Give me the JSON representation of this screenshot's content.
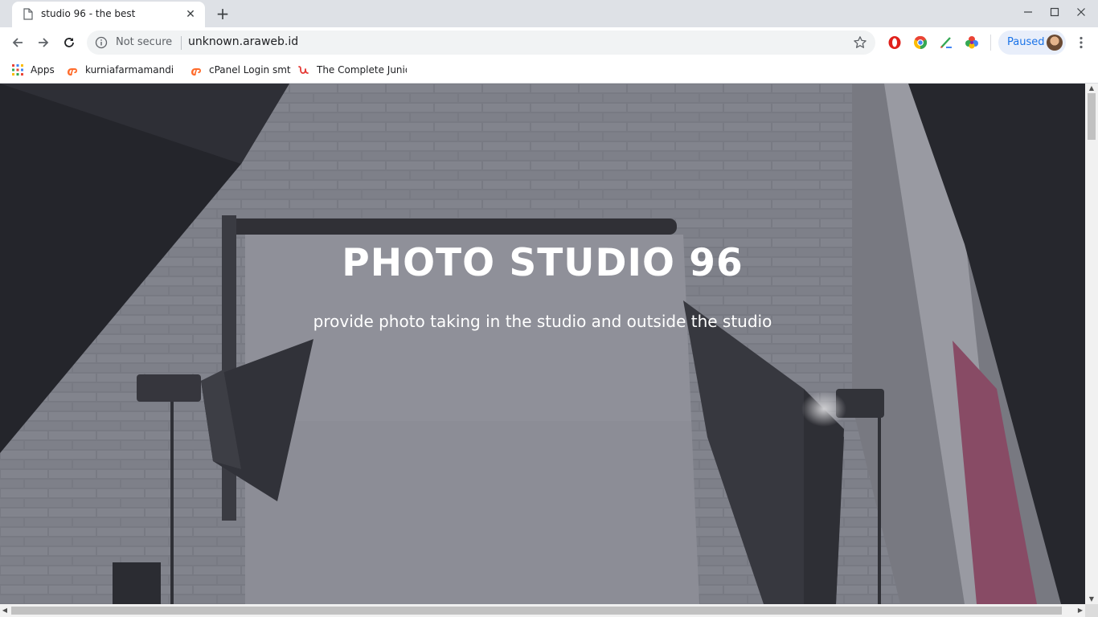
{
  "browser": {
    "tab": {
      "title": "studio 96 - the best",
      "close_glyph": "✕"
    },
    "new_tab_glyph": "+",
    "window_controls": {
      "minimize": "—",
      "maximize": "☐",
      "close": "✕"
    },
    "omnibox": {
      "security_label": "Not secure",
      "url": "unknown.araweb.id"
    },
    "profile": {
      "label": "Paused"
    },
    "extensions": [
      "opera-icon",
      "chrome-colored-icon",
      "paint-brush-icon",
      "color-wheel-icon"
    ]
  },
  "bookmarks": [
    {
      "label": "Apps",
      "icon": "apps-grid-icon"
    },
    {
      "label": "kurniafarmamandiri",
      "icon": "cpanel-icon"
    },
    {
      "label": "cPanel Login smt",
      "icon": "cpanel-icon"
    },
    {
      "label": "The Complete Junior",
      "icon": "script-u-icon"
    }
  ],
  "hero": {
    "title": "PHOTO STUDIO 96",
    "subtitle": "provide photo taking in the studio and outside the studio"
  },
  "colors": {
    "accent": "#1a73e8",
    "tabstrip": "#dee1e6",
    "cpanel_orange": "#ff6c2c",
    "overlay": "#555a66"
  }
}
